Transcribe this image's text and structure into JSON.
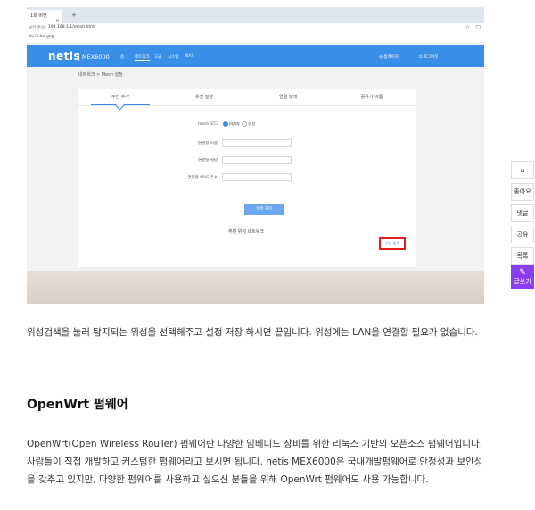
{
  "screenshot": {
    "browser": {
      "tab_label": "1회 버전",
      "tab_close": "×",
      "tab_new": "+",
      "address_status": "보안 주의",
      "address_url": "192.168.1.1/mesh.html",
      "bookmarks": [
        "YouTube",
        "번역 "
      ]
    },
    "router": {
      "brand": "netis",
      "model": "MEX6000",
      "nav": [
        "홈",
        "네트워크",
        "고급",
        "시스템",
        "NAS"
      ],
      "nav_right_home": "◎ 홈페이지",
      "nav_right_logout": "⏻ 로그아웃",
      "breadcrumb": "네트워크 > Mesh 설정",
      "tabs": [
        "무선 추가",
        "유선 설정",
        "연결 상태",
        "공유기 이름"
      ],
      "mesh_mode_label": "mesh 모드",
      "mesh_mode_main": "MAIN",
      "mesh_mode_sub": "위성",
      "field_conn_name": "연결할 이름",
      "field_conn_channel": "연결할 채널",
      "field_conn_mac": "연결할 MAC 주소",
      "save_button": "설정 저장",
      "nearby_title": "주변 위성 네트워크",
      "scan_button": "위성 검색"
    }
  },
  "article": {
    "para1": "위성검색을 눌러 탐지되는 위성을 선택해주고 설정 저장 하시면 끝입니다. 위성에는 LAN을 연결할 필요가 없습니다.",
    "heading": "OpenWrt 펌웨어",
    "para2": "OpenWrt(Open Wireless RouTer) 펌웨어란 다양한 임베디드 장비를 위한 리눅스 기반의 오픈소스 펌웨어입니다. 사람들이 직접 개발하고 커스텀한 펌웨어라고 보시면 됩니다. netis MEX6000은 국내개발펌웨어로 안정성과 보안성을 갖추고 있지만, 다양한 펌웨어를 사용하고 싶으신 분들을 위해 OpenWrt 펌웨어도 사용 가능합니다."
  },
  "sidebar": {
    "home_icon": "⌂",
    "like": "좋아요",
    "comment": "댓글",
    "share": "공유",
    "more": "목록",
    "write_icon": "✎",
    "write": "글쓰기"
  },
  "colors": {
    "router_nav": "#3a8ee8",
    "highlight_box": "#e41e1e",
    "write_button": "#8a3ef0"
  }
}
